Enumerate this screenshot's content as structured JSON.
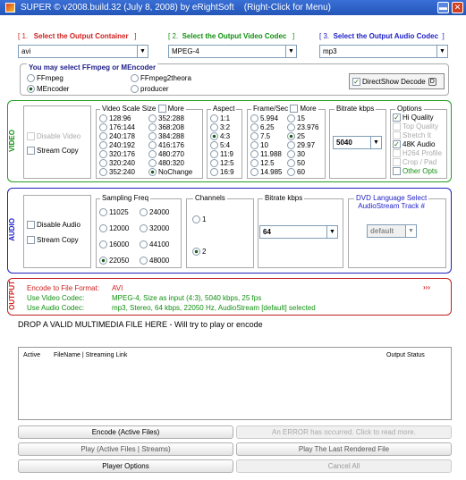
{
  "window": {
    "title": "SUPER © v2008.build.32 (July 8, 2008) by eRightSoft",
    "hint": "(Right-Click for Menu)",
    "min": "▬",
    "close": "✕"
  },
  "headers": {
    "n1": "[ 1.",
    "t1": "Select the Output Container",
    "e1": "]",
    "n2": "[ 2.",
    "t2": "Select the Output Video Codec",
    "e2": "]",
    "n3": "[ 3.",
    "t3": "Select the Output Audio Codec",
    "e3": "]"
  },
  "selects": {
    "container": "avi",
    "video_codec": "MPEG-4",
    "audio_codec": "mp3"
  },
  "encoder": {
    "label": "You may select FFmpeg or MEncoder",
    "ffmpeg": "FFmpeg",
    "ffmpeg2theora": "FFmpeg2theora",
    "mencoder": "MEncoder",
    "producer": "producer",
    "directshow": "DirectShow Decode",
    "selected": "MEncoder",
    "directshow_checked": true
  },
  "video": {
    "side": "VIDEO",
    "disable": "Disable Video",
    "stream_copy": "Stream Copy",
    "scale_label": "Video Scale Size",
    "more": "More",
    "scale_left": [
      "128:96",
      "176:144",
      "240:178",
      "240:192",
      "320:176",
      "320:240",
      "352:240"
    ],
    "scale_right": [
      "352:288",
      "368:208",
      "384:288",
      "416:176",
      "480:270",
      "480:320",
      "NoChange"
    ],
    "scale_selected": "NoChange",
    "aspect_label": "Aspect",
    "aspect": [
      "1:1",
      "3:2",
      "4:3",
      "5:4",
      "11:9",
      "12:5",
      "16:9"
    ],
    "aspect_selected": "4:3",
    "fps_label": "Frame/Sec",
    "fps_left": [
      "5.994",
      "6.25",
      "7.5",
      "10",
      "11.988",
      "12.5",
      "14.985"
    ],
    "fps_right": [
      "15",
      "23.976",
      "25",
      "29.97",
      "30",
      "50",
      "60"
    ],
    "fps_selected": "25",
    "bitrate_label": "Bitrate  kbps",
    "bitrate": "5040",
    "options_label": "Options",
    "options": [
      {
        "label": "Hi Quality",
        "checked": true,
        "enabled": true
      },
      {
        "label": "Top Quality",
        "checked": false,
        "enabled": false
      },
      {
        "label": "Stretch It",
        "checked": false,
        "enabled": false
      },
      {
        "label": "48K Audio",
        "checked": true,
        "enabled": true
      },
      {
        "label": "H264 Profile",
        "checked": false,
        "enabled": false
      },
      {
        "label": "Crop / Pad",
        "checked": false,
        "enabled": false
      },
      {
        "label": "Other Opts",
        "checked": false,
        "enabled": true
      }
    ]
  },
  "audio": {
    "side": "AUDIO",
    "disable": "Disable Audio",
    "stream_copy": "Stream Copy",
    "freq_label": "Sampling Freq",
    "freq_left": [
      "11025",
      "12000",
      "16000",
      "22050"
    ],
    "freq_right": [
      "24000",
      "32000",
      "44100",
      "48000"
    ],
    "freq_selected": "22050",
    "channels_label": "Channels",
    "channels": [
      "1",
      "2"
    ],
    "channels_selected": "2",
    "bitrate_label": "Bitrate  kbps",
    "bitrate": "64",
    "dvd_label1": "DVD Language Select",
    "dvd_label2": "AudioStream  Track #",
    "dvd_value": "default"
  },
  "output": {
    "side": "OUTPUT",
    "more": "›››",
    "rows": [
      {
        "k": "Encode to File Format:",
        "v": "AVI"
      },
      {
        "k": "Use Video Codec:",
        "v": "MPEG-4,  Size as input (4:3),  5040 kbps,  25 fps"
      },
      {
        "k": "Use Audio Codec:",
        "v": "mp3,  Stereo,  64 kbps,  22050 Hz,  AudioStream [default] selected"
      }
    ]
  },
  "drop_text": "DROP A VALID MULTIMEDIA FILE HERE - Will try to play or encode",
  "table": {
    "c1": "Active",
    "c2": "FileName  |  Streaming Link",
    "c3": "Output Status"
  },
  "buttons": {
    "encode": "Encode (Active Files)",
    "error": "An ERROR has occurred. Click to read more.",
    "play": "Play (Active Files | Streams)",
    "play_last": "Play The Last Rendered File",
    "player_options": "Player Options",
    "cancel_all": "Cancel All"
  },
  "colors": {
    "red": "#d02020",
    "green": "#109010",
    "blue": "#2020c8",
    "accent": "#2456b8"
  }
}
